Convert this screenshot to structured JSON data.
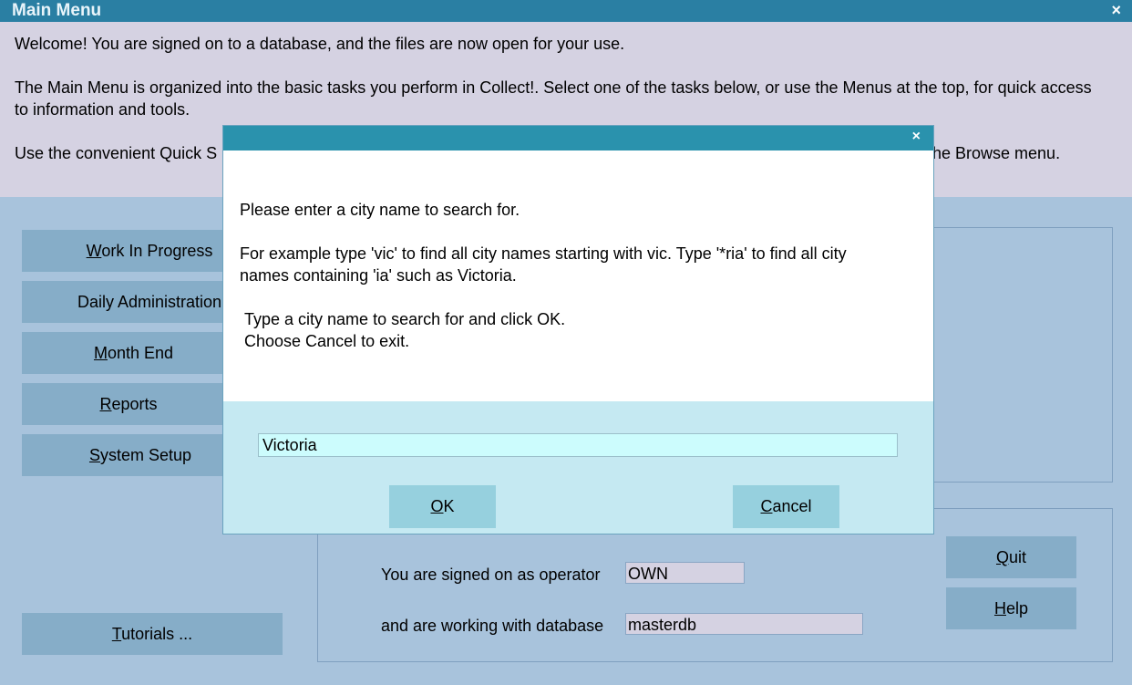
{
  "window": {
    "title": "Main Menu",
    "close_glyph": "×"
  },
  "intro": {
    "line1": "Welcome! You are signed on to a database, and the files are now open for your use.",
    "line2": "The Main Menu is organized into the basic tasks you perform in Collect!. Select one of the tasks below, or use the Menus at the top, for quick access to information and tools.",
    "line3_left": "Use the convenient Quick S",
    "line3_right": "he Browse menu."
  },
  "tasks": [
    {
      "mnemonic": "W",
      "rest": "ork In Progress"
    },
    {
      "mnemonic": "",
      "rest": "Daily Administration"
    },
    {
      "mnemonic": "M",
      "rest": "onth End"
    },
    {
      "mnemonic": "R",
      "rest": "eports"
    },
    {
      "mnemonic": "S",
      "rest": "ystem Setup"
    }
  ],
  "tutorials": {
    "mnemonic": "T",
    "rest": "utorials ..."
  },
  "operator": {
    "operator_label": "You are signed on as operator",
    "operator_value": "OWN",
    "database_label": "and are working with database",
    "database_value": "masterdb"
  },
  "side_buttons": {
    "quit": {
      "mnemonic": "Q",
      "rest": "uit"
    },
    "help": {
      "mnemonic": "H",
      "rest": "elp"
    }
  },
  "dialog": {
    "close_glyph": "×",
    "p1": "Please enter a city name to search for.",
    "p2": "For example type 'vic' to find all city names starting with vic. Type '*ria' to find all city names containing 'ia' such as Victoria.",
    "p3a": "Type a city name to search for and click OK.",
    "p3b": "Choose Cancel to exit.",
    "input_value": "Victoria",
    "ok": {
      "mnemonic": "O",
      "rest": "K"
    },
    "cancel": {
      "mnemonic": "C",
      "rest": "ancel"
    }
  },
  "colors": {
    "titlebar": "#2a7fa3",
    "background": "#a8c3dc",
    "dialog_title": "#2a92ad",
    "dialog_input": "#ccfcfd"
  }
}
